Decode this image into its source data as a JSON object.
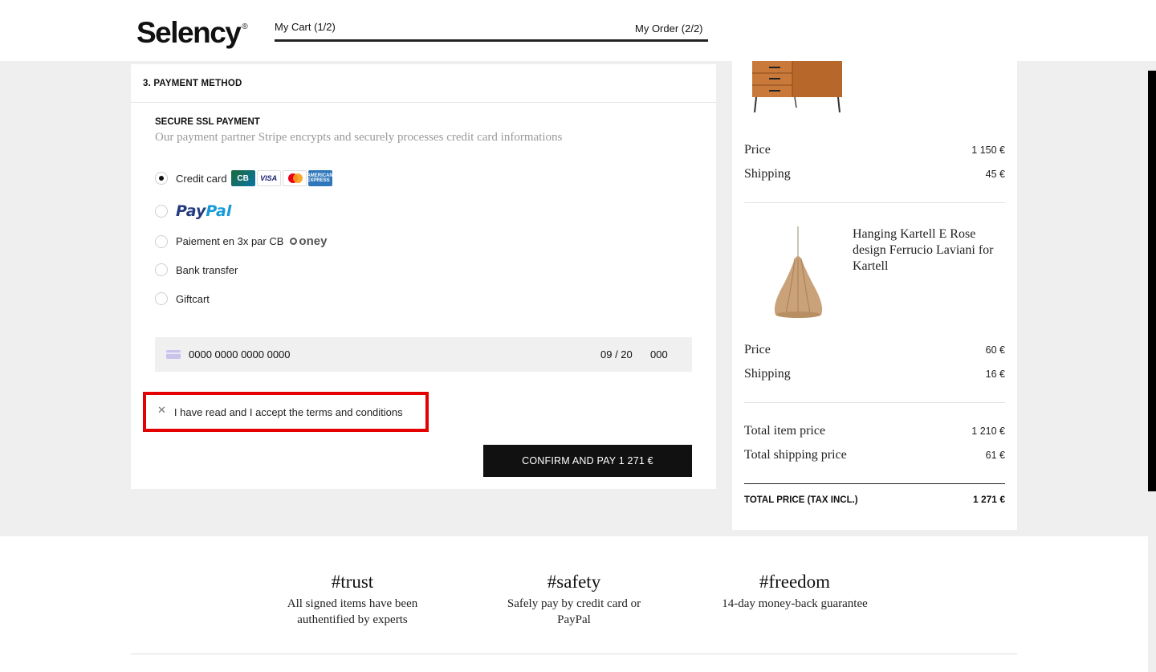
{
  "header": {
    "logo": "Selency",
    "logo_reg": "®",
    "step_cart": "My Cart (1/2)",
    "step_order": "My Order (2/2)"
  },
  "payment": {
    "title": "3. PAYMENT METHOD",
    "ssl_title": "SECURE SSL PAYMENT",
    "ssl_desc": "Our payment partner Stripe encrypts and securely processes credit card informations",
    "options": [
      {
        "label": "Credit card",
        "selected": true
      },
      {
        "label": "PayPal",
        "selected": false
      },
      {
        "label": "Paiement en 3x par CB",
        "selected": false
      },
      {
        "label": "Bank transfer",
        "selected": false
      },
      {
        "label": "Giftcart",
        "selected": false
      }
    ],
    "card_logos": {
      "cb": "CB",
      "visa": "VISA",
      "amex": "AMERICAN EXPRESS"
    },
    "paypal_logo": {
      "a": "Pay",
      "b": "Pal"
    },
    "oney_logo": "oney",
    "card_input": {
      "number": "0000 0000 0000 0000",
      "expiry": "09 / 20",
      "cvc": "000"
    },
    "terms_label": "I have read and I accept the terms and conditions",
    "confirm_label": "CONFIRM AND PAY 1 271 €"
  },
  "summary": {
    "item1": {
      "price_label": "Price",
      "price": "1 150 €",
      "shipping_label": "Shipping",
      "shipping": "45 €"
    },
    "item2": {
      "name": "Hanging Kartell E Rose design Ferrucio Laviani for Kartell",
      "price_label": "Price",
      "price": "60 €",
      "shipping_label": "Shipping",
      "shipping": "16 €"
    },
    "total_item_label": "Total item price",
    "total_item": "1 210 €",
    "total_shipping_label": "Total shipping price",
    "total_shipping": "61 €",
    "total_label": "TOTAL PRICE (TAX INCL.)",
    "total": "1 271 €"
  },
  "footer": {
    "features": [
      {
        "title": "#trust",
        "desc1": "All signed items have been",
        "desc2": "authentified by experts"
      },
      {
        "title": "#safety",
        "desc1": "Safely pay by credit card or",
        "desc2": "PayPal"
      },
      {
        "title": "#freedom",
        "desc1": "14-day money-back guarantee",
        "desc2": ""
      }
    ]
  }
}
